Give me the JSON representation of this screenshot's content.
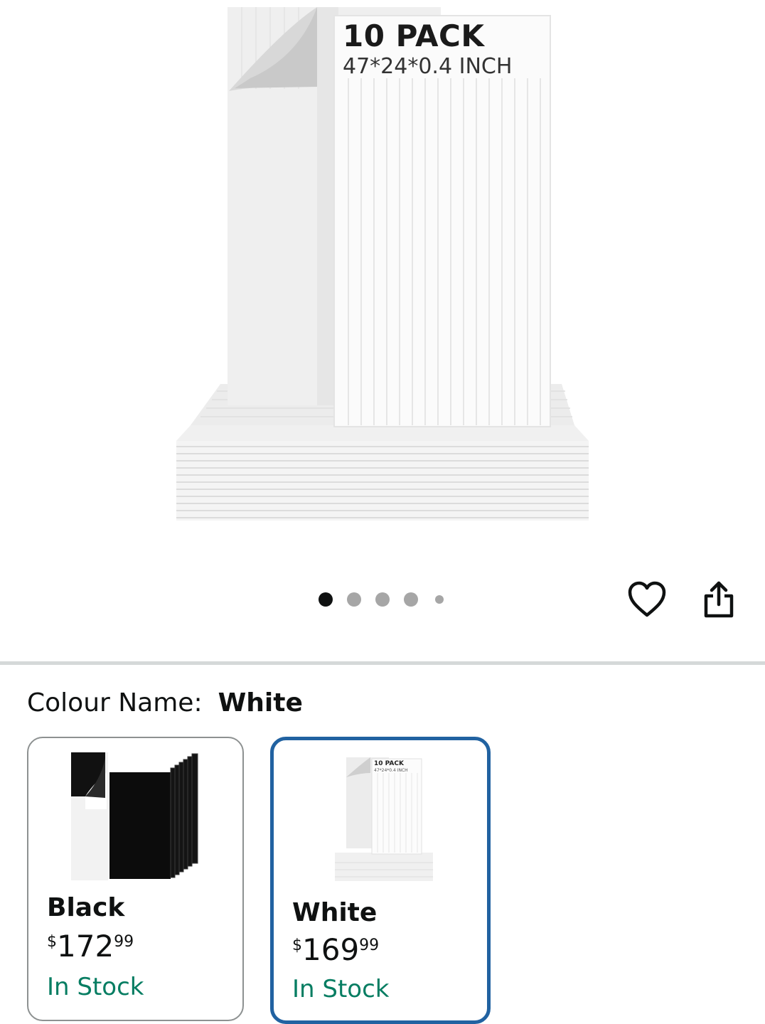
{
  "product_image": {
    "banner_title": "10 PACK",
    "banner_subtitle": "47*24*0.4 INCH"
  },
  "gallery": {
    "image_count": 5,
    "active_index": 0
  },
  "actions": {
    "wishlist_icon": "heart-icon",
    "share_icon": "share-icon"
  },
  "variation": {
    "label": "Colour Name:",
    "selected_value": "White",
    "options": [
      {
        "name": "Black",
        "currency": "$",
        "price_whole": "172",
        "price_fraction": "99",
        "availability": "In Stock",
        "selected": false
      },
      {
        "name": "White",
        "currency": "$",
        "price_whole": "169",
        "price_fraction": "99",
        "availability": "In Stock",
        "selected": true,
        "thumb_title": "10 PACK",
        "thumb_subtitle": "47*24*0.4 INCH"
      }
    ]
  },
  "colors": {
    "selected_border": "#2162a1",
    "stock_green": "#067d62",
    "active_dot": "#0f1111",
    "inactive_dot": "#a6a6a6"
  }
}
